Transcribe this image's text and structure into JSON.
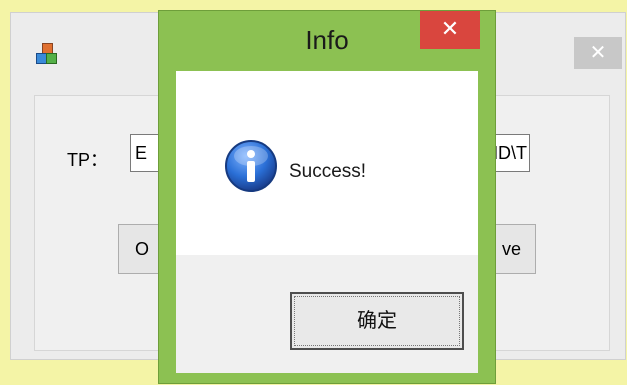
{
  "main_window": {
    "close_symbol": "✕",
    "tp_label": "TP：",
    "tp_value_start": "E",
    "tp_value_end": "HD\\T",
    "left_button_label": "O",
    "right_button_label": "ve"
  },
  "dialog": {
    "title": "Info",
    "close_symbol": "✕",
    "message": "Success!",
    "ok_label": "确定",
    "icon": "info-icon"
  },
  "colors": {
    "dialog_frame": "#8cc152",
    "dialog_close": "#d9463e",
    "info_icon": "#1f5fbf"
  }
}
